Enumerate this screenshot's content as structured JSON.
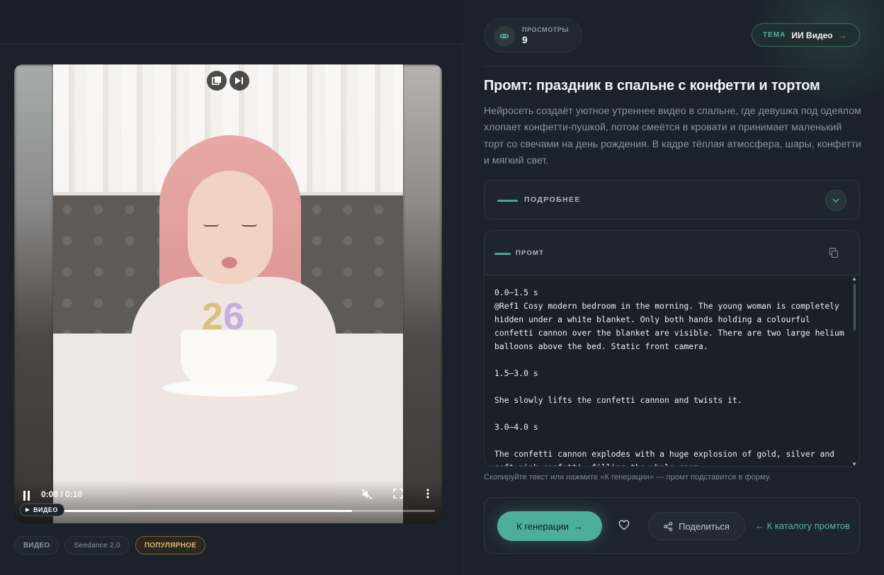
{
  "stats": {
    "views_label": "ПРОСМОТРЫ",
    "views_value": "9"
  },
  "theme": {
    "key": "ТЕМА",
    "value": "ИИ Видео",
    "arrow": "→"
  },
  "page": {
    "title": "Промт: праздник в спальне с конфетти и тортом",
    "description": "Нейросеть создаёт уютное утреннее видео в спальне, где девушка под одеялом хлопает конфетти-пушкой, потом смеётся в кровати и принимает маленький торт со свечами на день рождения. В кадре тёплая атмосфера, шары, конфетти и мягкий свет."
  },
  "details": {
    "label": "ПОДРОБНЕЕ"
  },
  "prompt": {
    "label": "ПРОМТ",
    "text": "0.0–1.5 s\n@Ref1 Cosy modern bedroom in the morning. The young woman is completely hidden under a white blanket. Only both hands holding a colourful confetti cannon over the blanket are visible. There are two large helium balloons above the bed. Static front camera.\n\n1.5–3.0 s\n\nShe slowly lifts the confetti cannon and twists it.\n\n3.0–4.0 s\n\nThe confetti cannon explodes with a huge explosion of gold, silver and soft pink confetti, filling the whole room."
  },
  "hint": "Скопируйте текст или нажмите «К генерации» — промт подставится в форму.",
  "actions": {
    "generate": "К генерации",
    "generate_arrow": "→",
    "share": "Поделиться",
    "catalog": "← К каталогу промтов"
  },
  "video": {
    "time": "0:08 / 0:10",
    "progress": 0.8,
    "badge": "ВИДЕО",
    "candles": {
      "d1": "2",
      "d2": "6"
    }
  },
  "tags": [
    {
      "label": "ВИДЕО"
    },
    {
      "label": "Seedance 2.0"
    },
    {
      "label": "ПОПУЛЯРНОЕ"
    }
  ],
  "colors": {
    "accent": "#4eae9c",
    "popular": "#e0b864",
    "background": "#1c222b"
  }
}
